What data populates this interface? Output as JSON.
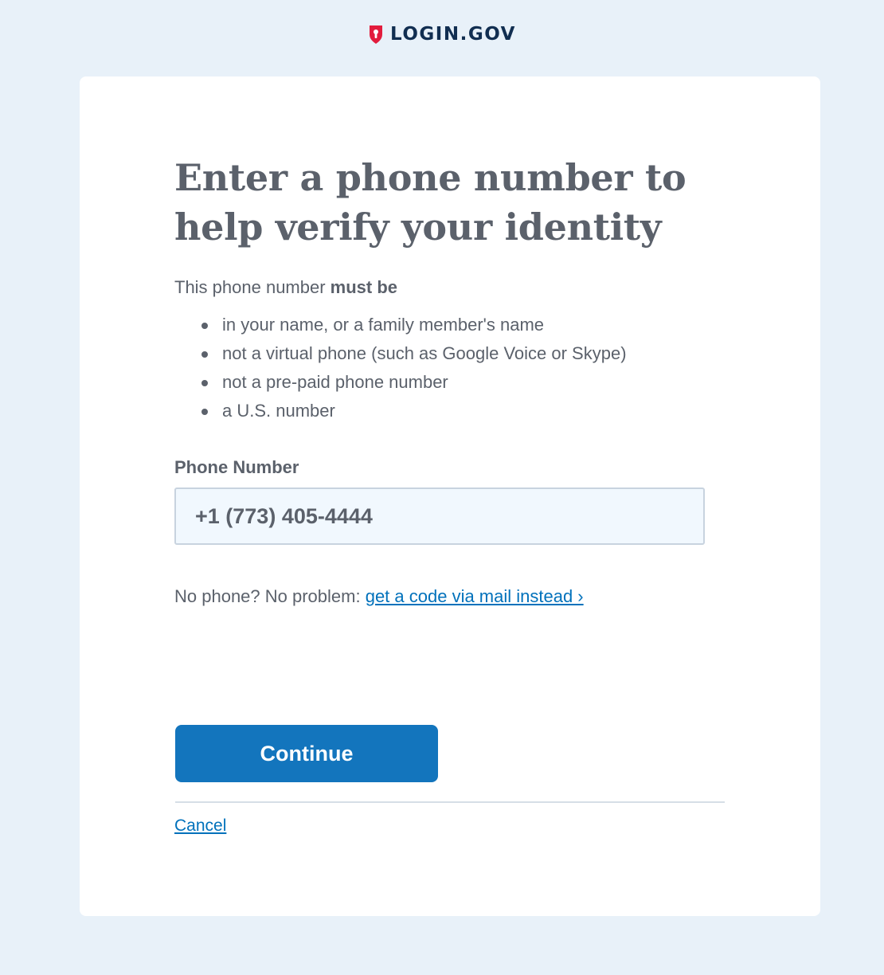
{
  "header": {
    "logo_text": "LOGIN.GOV",
    "logo_icon": "shield-lock-icon",
    "logo_color": "#e21c3d"
  },
  "main": {
    "title": "Enter a phone number to help verify your identity",
    "intro_prefix": "This phone number ",
    "intro_bold": "must be",
    "requirements": [
      "in your name, or a family member's name",
      "not a virtual phone (such as Google Voice or Skype)",
      "not a pre-paid phone number",
      "a U.S. number"
    ],
    "phone_label": "Phone Number",
    "phone_value": "+1 (773) 405-4444",
    "alt_prefix": "No phone? No problem: ",
    "alt_link": "get a code via mail instead ›",
    "continue_label": "Continue",
    "cancel_label": "Cancel"
  },
  "colors": {
    "background": "#e8f1f9",
    "primary": "#1375bd",
    "link": "#0071bb",
    "text": "#5b616b"
  }
}
